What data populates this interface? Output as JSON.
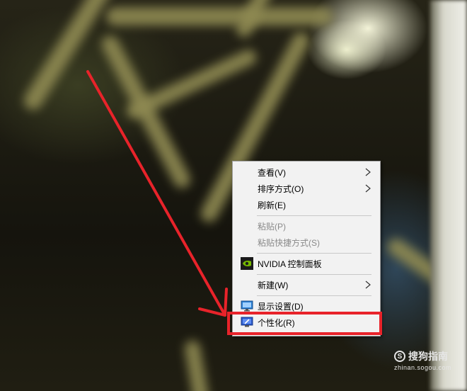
{
  "context_menu": {
    "items": [
      {
        "label": "查看(V)",
        "submenu": true,
        "enabled": true
      },
      {
        "label": "排序方式(O)",
        "submenu": true,
        "enabled": true
      },
      {
        "label": "刷新(E)",
        "submenu": false,
        "enabled": true
      },
      {
        "label": "粘贴(P)",
        "submenu": false,
        "enabled": false
      },
      {
        "label": "粘贴快捷方式(S)",
        "submenu": false,
        "enabled": false
      },
      {
        "label": "NVIDIA 控制面板",
        "icon": "nvidia-icon",
        "submenu": false,
        "enabled": true
      },
      {
        "label": "新建(W)",
        "submenu": true,
        "enabled": true
      },
      {
        "label": "显示设置(D)",
        "icon": "display-settings-icon",
        "submenu": false,
        "enabled": true
      },
      {
        "label": "个性化(R)",
        "icon": "personalize-icon",
        "submenu": false,
        "enabled": true,
        "highlighted": true
      }
    ]
  },
  "annotation": {
    "arrow_color": "#e8232a",
    "highlight_color": "#e8232a"
  },
  "watermark": {
    "logo_glyph": "S",
    "brand": "搜狗指南",
    "site": "zhinan.sogou.com"
  }
}
